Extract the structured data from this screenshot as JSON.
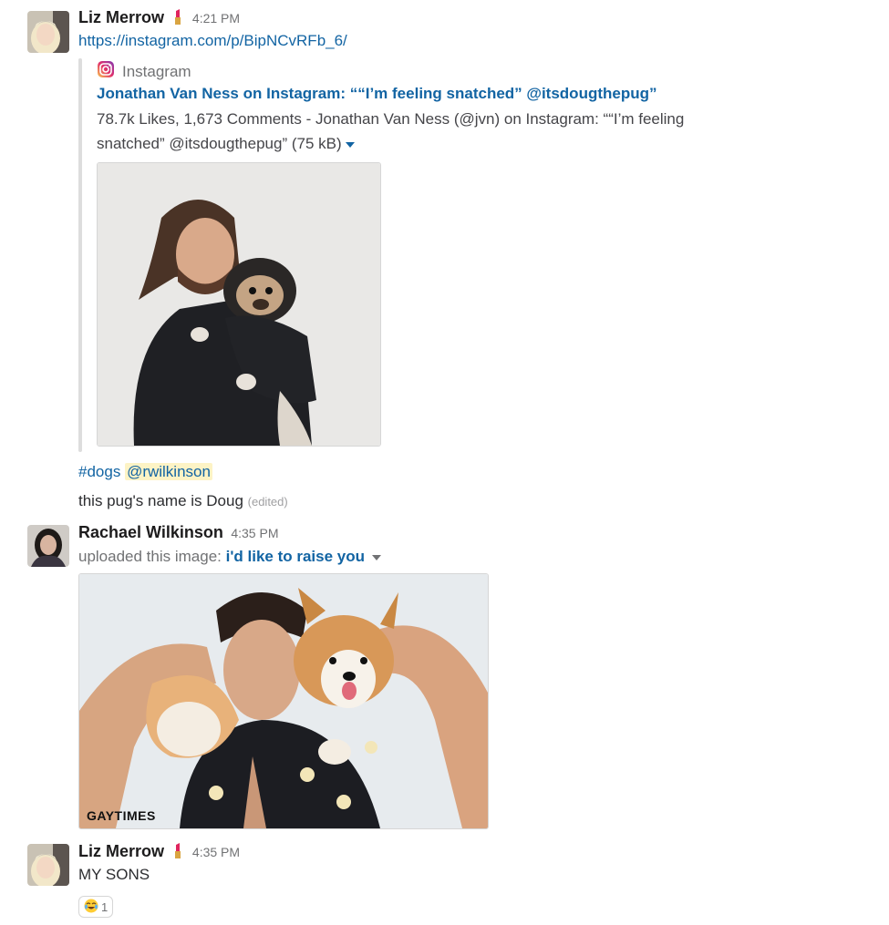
{
  "messages": [
    {
      "author": "Liz Merrow",
      "time": "4:21 PM",
      "link": "https://instagram.com/p/BipNCvRFb_6/",
      "unfurl": {
        "service": "Instagram",
        "title": "Jonathan Van Ness on Instagram: ““I’m feeling snatched” @itsdougthepug”",
        "desc_line1": "78.7k Likes, 1,673 Comments - Jonathan Van Ness (@jvn) on Instagram: ““I’m feeling",
        "desc_line2": "snatched” @itsdougthepug” (75 kB)"
      },
      "hashtag": "#dogs",
      "mention": "@rwilkinson",
      "text": "this pug's name is Doug",
      "edited": "(edited)"
    },
    {
      "author": "Rachael Wilkinson",
      "time": "4:35 PM",
      "upload_prefix": "uploaded this image:",
      "upload_name": "i'd like to raise you",
      "image_caption": "GAYTIMES"
    },
    {
      "author": "Liz Merrow",
      "time": "4:35 PM",
      "text": "MY SONS",
      "reaction": {
        "emoji": "joy-emoji",
        "count": "1"
      }
    }
  ],
  "icons": {
    "author_status": "lipstick-icon",
    "service": "instagram-icon",
    "expand": "caret-down-icon"
  },
  "colors": {
    "link": "#1264a3",
    "mention_bg": "#fdf3c5",
    "text": "#2c2d30",
    "muted": "#717274"
  }
}
